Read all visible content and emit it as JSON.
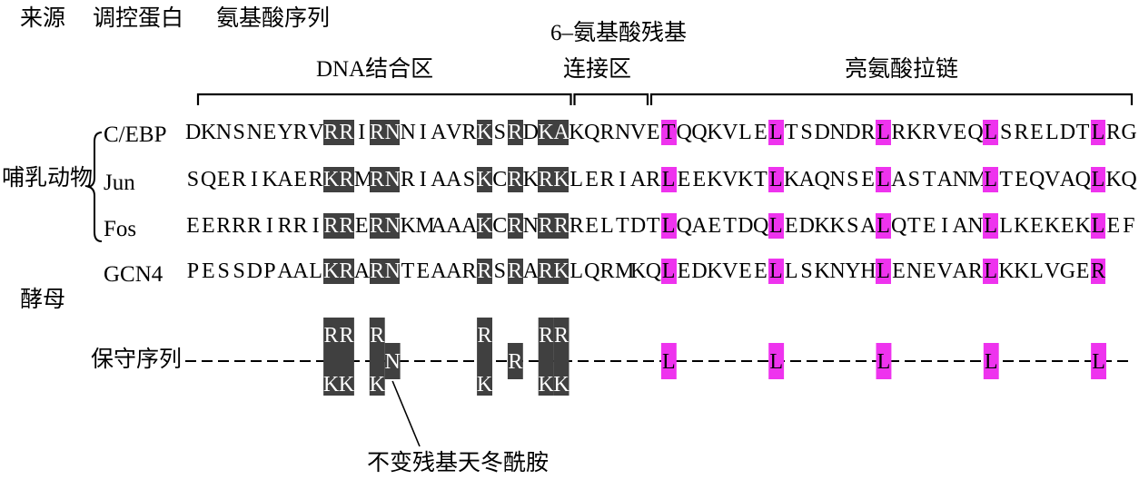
{
  "headers": {
    "source": "来源",
    "protein": "调控蛋白",
    "sequence": "氨基酸序列"
  },
  "region_labels": {
    "dna_binding": "DNA结合区",
    "linker_top": "6–氨基酸残基",
    "linker_bottom": "连接区",
    "zipper": "亮氨酸拉链"
  },
  "groups": {
    "mammal": "哺乳动物",
    "yeast": "酵母"
  },
  "proteins": [
    {
      "name": "C/EBP",
      "sequence": "DKNSNEYRVRRIRNNIAVRKSRDKAKQRNVETQQKVLELTSDNDRLRKRVEQLSRELDTLRG-"
    },
    {
      "name": "Jun",
      "sequence": "SQERIKAERKRMRNRIAASKCRKRKLERIARLEEKVKTLKAQNSELASTANMLTEQVAQLKQ-"
    },
    {
      "name": "Fos",
      "sequence": "EERRRIRRIRRERNKMAAAKCRNRRRELTDTLQAETDQLEDKKSALQTEIANLLKEKEKLEF-"
    },
    {
      "name": "GCN4",
      "sequence": "PESSDPAALKRARNTEAARRSRARKLQRMKQLEDKVEELLSKNYHLENEVARLKKLVGER"
    }
  ],
  "conserved": {
    "label": "保守序列",
    "residues": [
      {
        "pos": 9,
        "top": "R",
        "bottom": "K"
      },
      {
        "pos": 10,
        "top": "R",
        "bottom": "K"
      },
      {
        "pos": 12,
        "top": "R",
        "bottom": "K"
      },
      {
        "pos": 13,
        "mid": "N"
      },
      {
        "pos": 19,
        "top": "R",
        "bottom": "K"
      },
      {
        "pos": 21,
        "mid": "R"
      },
      {
        "pos": 23,
        "top": "R",
        "bottom": "K"
      },
      {
        "pos": 24,
        "top": "R",
        "bottom": "K"
      },
      {
        "pos": 31,
        "mid": "L"
      },
      {
        "pos": 38,
        "mid": "L"
      },
      {
        "pos": 45,
        "mid": "L"
      },
      {
        "pos": 52,
        "mid": "L"
      },
      {
        "pos": 59,
        "mid": "L"
      }
    ]
  },
  "annotation": "不变残基天冬酰胺",
  "highlights": {
    "gray_positions": [
      9,
      10,
      12,
      13,
      19,
      21,
      23,
      24
    ],
    "pink_positions": [
      31,
      38,
      45,
      52,
      59
    ]
  },
  "colors": {
    "gray": "#404040",
    "pink": "#ee33ee"
  }
}
